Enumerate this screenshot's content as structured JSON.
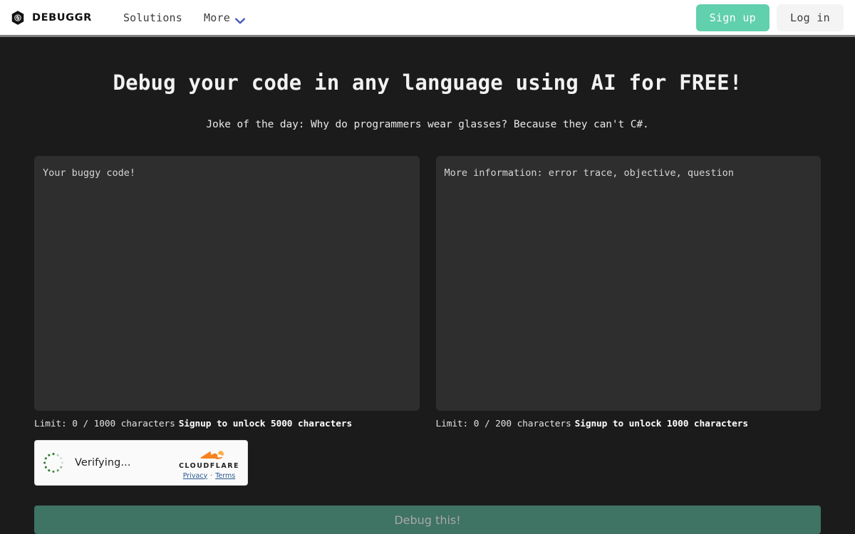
{
  "nav": {
    "brand": "DEBUGGR",
    "brand_icon": "hex-nut-code-icon",
    "links": [
      {
        "label": "Solutions",
        "icon": null
      },
      {
        "label": "More",
        "icon": "chevron-down-icon"
      }
    ],
    "signup_label": "Sign up",
    "login_label": "Log in",
    "accent_signup_bg": "#61d0ac",
    "login_bg": "#f4f4f4",
    "chevron_color": "#4a55c4"
  },
  "hero": {
    "headline": "Debug your code in any language using AI for FREE!",
    "joke": "Joke of the day: Why do programmers wear glasses? Because they can't C#."
  },
  "editors": [
    {
      "name": "code",
      "placeholder": "Your buggy code!",
      "value": "",
      "limit_text": "Limit: 0 / 1000 characters",
      "unlock_text": "Signup to unlock 5000 characters"
    },
    {
      "name": "details",
      "placeholder": "More information: error trace, objective, question",
      "value": "",
      "limit_text": "Limit: 0 / 200 characters",
      "unlock_text": "Signup to unlock 1000 characters"
    }
  ],
  "captcha": {
    "status": "Verifying...",
    "brand": "CLOUDFLARE",
    "privacy_label": "Privacy",
    "separator": "·",
    "terms_label": "Terms",
    "spinner_color": "#2f7d32",
    "cloud_color": "#f48120"
  },
  "submit": {
    "label": "Debug this!",
    "bg": "#3f7363",
    "text_color": "#a8a8a8"
  },
  "theme": {
    "page_bg": "#1b1b1b",
    "panel_bg": "#2e2e2e",
    "nav_bg": "#ffffff",
    "nav_border": "#808080"
  }
}
